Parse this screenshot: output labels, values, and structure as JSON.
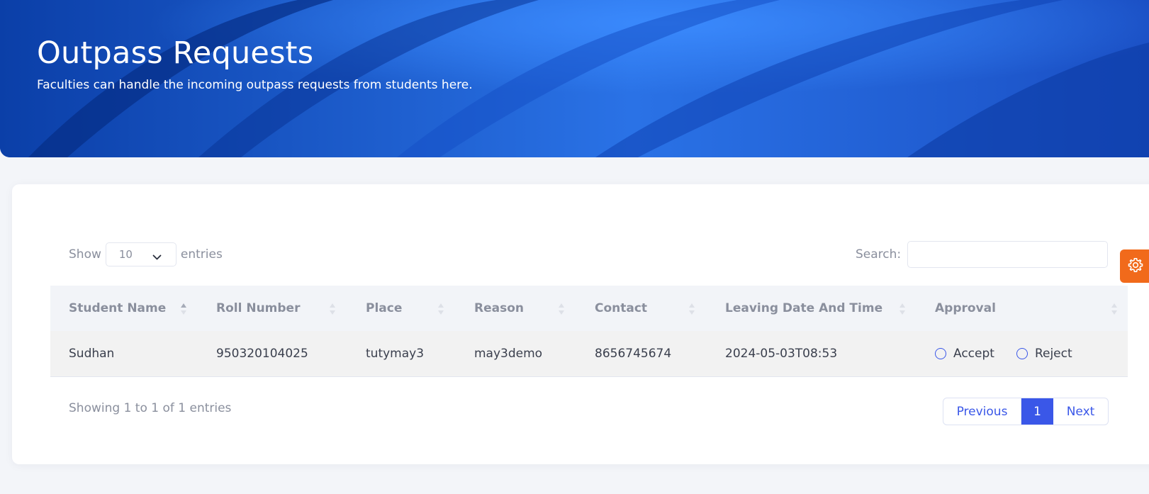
{
  "header": {
    "title": "Outpass Requests",
    "subtitle": "Faculties can handle the incoming outpass requests from students here."
  },
  "controls": {
    "show_label": "Show",
    "entries_value": "10",
    "entries_label": "entries",
    "search_label": "Search:",
    "search_value": ""
  },
  "table": {
    "columns": [
      {
        "label": "Student Name",
        "sort": "ascending"
      },
      {
        "label": "Roll Number",
        "sort": "none"
      },
      {
        "label": "Place",
        "sort": "none"
      },
      {
        "label": "Reason",
        "sort": "none"
      },
      {
        "label": "Contact",
        "sort": "none"
      },
      {
        "label": "Leaving Date And Time",
        "sort": "none"
      },
      {
        "label": "Approval",
        "sort": "none"
      }
    ],
    "rows": [
      {
        "student_name": "Sudhan",
        "roll_number": "950320104025",
        "place": "tutymay3",
        "reason": "may3demo",
        "contact": "8656745674",
        "leaving": "2024-05-03T08:53",
        "approval": {
          "accept_label": "Accept",
          "reject_label": "Reject",
          "selected": null
        }
      }
    ]
  },
  "footer": {
    "info": "Showing 1 to 1 of 1 entries",
    "previous_label": "Previous",
    "current_page": "1",
    "next_label": "Next"
  },
  "icons": {
    "settings": "gear-icon",
    "entries_dropdown": "chevron-down-icon",
    "sort": "sort-icon"
  },
  "colors": {
    "hero_blue": "#1046b8",
    "accent": "#3a57e8",
    "settings_orange": "#f16a1b",
    "muted_text": "#8a8f9d"
  }
}
